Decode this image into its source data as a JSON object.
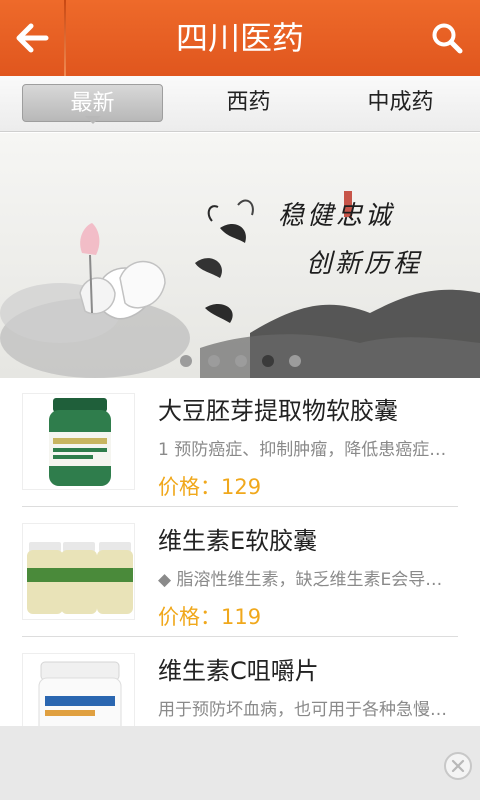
{
  "header": {
    "title": "四川医药",
    "back_icon": "arrow-left-icon",
    "search_icon": "search-icon",
    "bg_color": "#e8612a"
  },
  "tabs": [
    {
      "label": "最新",
      "active": true
    },
    {
      "label": "西药",
      "active": false
    },
    {
      "label": "中成药",
      "active": false
    }
  ],
  "banner": {
    "line1": "稳健忠诚",
    "line2": "创新历程",
    "slide_count": 5,
    "active_slide": 4
  },
  "products": [
    {
      "name": "大豆胚芽提取物软胶囊",
      "description": "1 预防癌症、抑制肿瘤，降低患癌症…",
      "price": "价格：129"
    },
    {
      "name": "维生素E软胶囊",
      "description": "◆ 脂溶性维生素，缺乏维生素E会导…",
      "price": "价格：119"
    },
    {
      "name": "维生素C咀嚼片",
      "description": "用于预防坏血病，也可用于各种急慢…",
      "price": ""
    }
  ],
  "ad": {
    "close_icon": "close-icon"
  },
  "colors": {
    "accent": "#e8612a",
    "price": "#f0a81c"
  }
}
